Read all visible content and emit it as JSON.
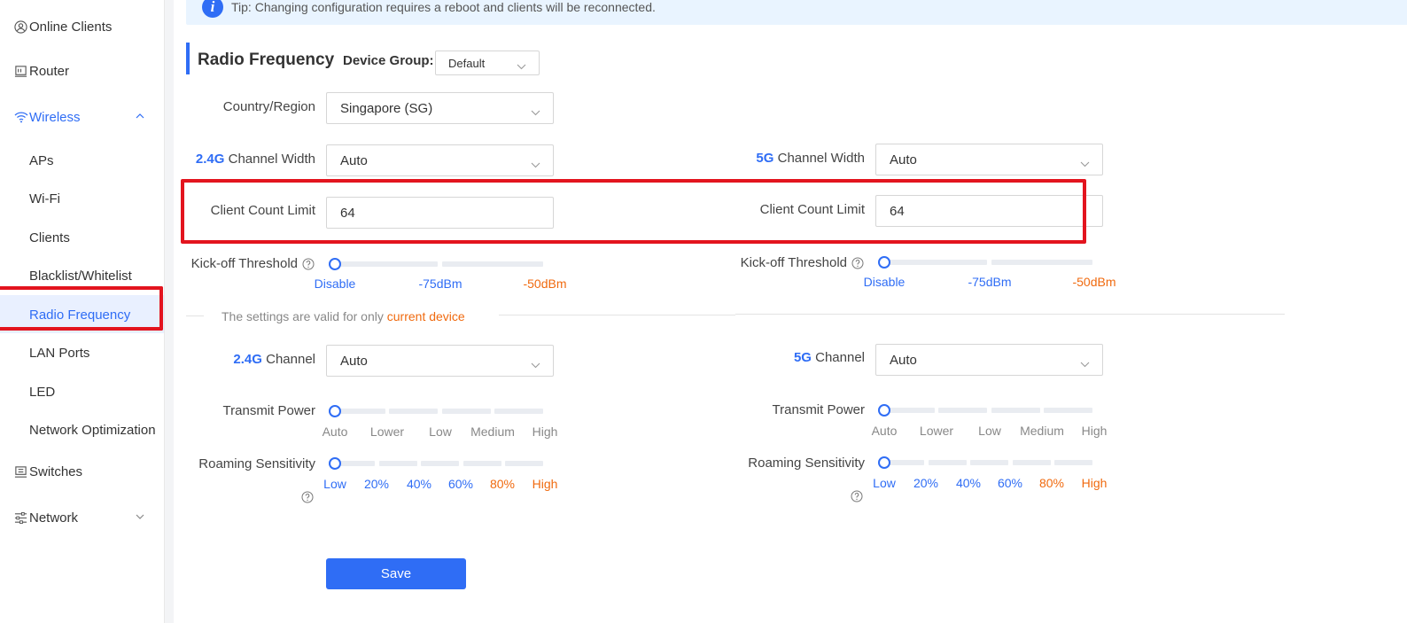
{
  "sidebar": {
    "online_clients": "Online Clients",
    "router": "Router",
    "wireless": "Wireless",
    "wireless_items": [
      "APs",
      "Wi-Fi",
      "Clients",
      "Blacklist/Whitelist",
      "Radio Frequency",
      "LAN Ports",
      "LED",
      "Network Optimization"
    ],
    "switches": "Switches",
    "network": "Network",
    "active_item": "Radio Frequency"
  },
  "tip": {
    "text": "Tip: Changing configuration requires a reboot and clients will be reconnected.",
    "icon": "info-icon"
  },
  "page": {
    "title": "Radio Frequency",
    "device_group_label": "Device Group:",
    "device_group_value": "Default"
  },
  "form": {
    "country_label": "Country/Region",
    "country_value": "Singapore (SG)",
    "band_24": "2.4G",
    "band_5": "5G",
    "channel_width_label": " Channel Width",
    "channel_width_24": "Auto",
    "channel_width_5": "Auto",
    "client_count_label": "Client Count Limit",
    "client_count_24": "64",
    "client_count_5": "64",
    "kickoff_label": "Kick-off Threshold",
    "kickoff_ticks": [
      "Disable",
      "-75dBm",
      "-50dBm"
    ],
    "kickoff_24_value": "Disable",
    "kickoff_5_value": "Disable",
    "divider_text_prefix": "The settings are valid for only ",
    "divider_text_highlight": "current device",
    "channel_label": " Channel",
    "channel_24": "Auto",
    "channel_5": "Auto",
    "transmit_power_label": "Transmit Power",
    "transmit_power_ticks": [
      "Auto",
      "Lower",
      "Low",
      "Medium",
      "High"
    ],
    "transmit_power_24_value": "Auto",
    "transmit_power_5_value": "Auto",
    "roaming_label": "Roaming Sensitivity",
    "roaming_ticks": [
      "Low",
      "20%",
      "40%",
      "60%",
      "80%",
      "High"
    ],
    "roaming_24_value": "Low",
    "roaming_5_value": "Low",
    "save_label": "Save"
  },
  "colors": {
    "accent": "#2f6df5",
    "warning": "#f06a0f",
    "highlight": "#e3141e"
  }
}
